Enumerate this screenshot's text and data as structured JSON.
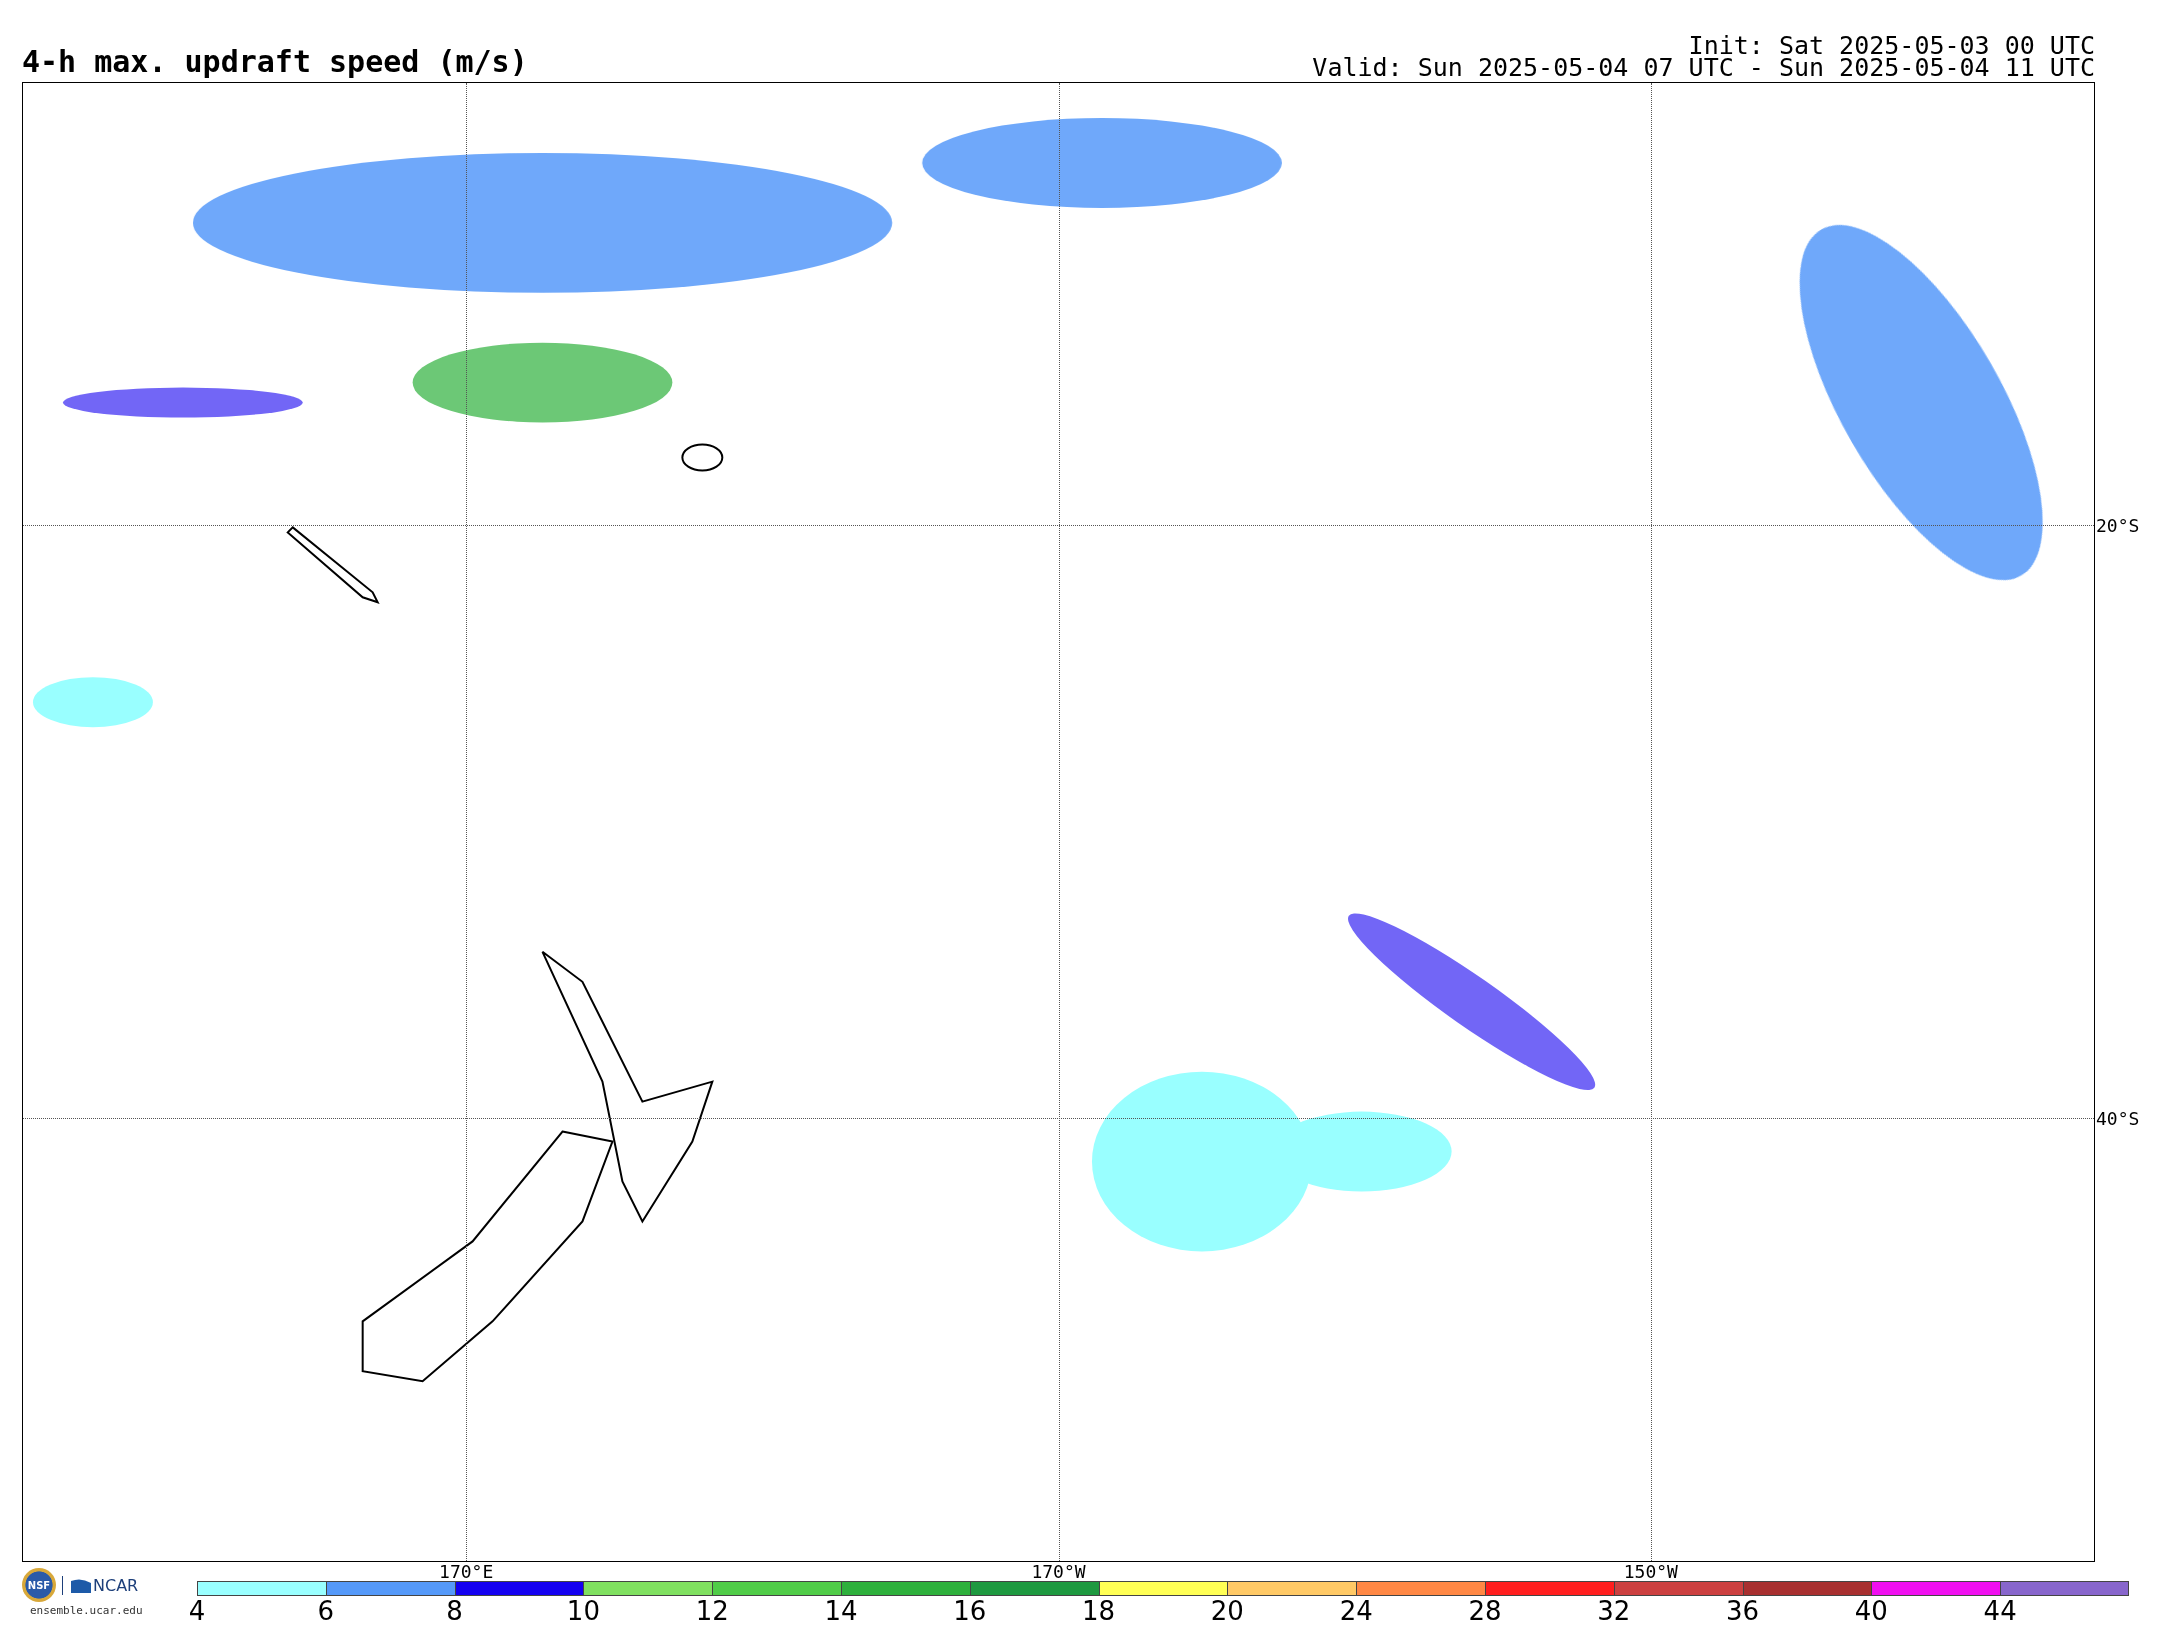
{
  "title": "4-h max. updraft speed (m/s)",
  "init": "Init: Sat 2025-05-03 00 UTC",
  "valid": "Valid: Sun 2025-05-04 07 UTC - Sun 2025-05-04 11 UTC",
  "lat_labels": [
    "20°S",
    "40°S"
  ],
  "lon_labels": [
    "170°E",
    "170°W",
    "150°W"
  ],
  "logo": {
    "seal": "NSF",
    "name": "NCAR",
    "site": "ensemble.ucar.edu"
  },
  "colorbar": [
    {
      "color": "#99ffff",
      "label": "4"
    },
    {
      "color": "#5599f9",
      "label": "6"
    },
    {
      "color": "#1400f0",
      "label": "8"
    },
    {
      "color": "#80e060",
      "label": "10"
    },
    {
      "color": "#50cc48",
      "label": "12"
    },
    {
      "color": "#2eb03c",
      "label": "14"
    },
    {
      "color": "#1e9940",
      "label": "16"
    },
    {
      "color": "#ffff55",
      "label": "18"
    },
    {
      "color": "#ffc966",
      "label": "20"
    },
    {
      "color": "#ff8845",
      "label": "24"
    },
    {
      "color": "#ff1e1e",
      "label": "28"
    },
    {
      "color": "#cc4040",
      "label": "32"
    },
    {
      "color": "#a83030",
      "label": "36"
    },
    {
      "color": "#f00ff0",
      "label": "40"
    },
    {
      "color": "#8866cc",
      "label": "44"
    }
  ]
}
